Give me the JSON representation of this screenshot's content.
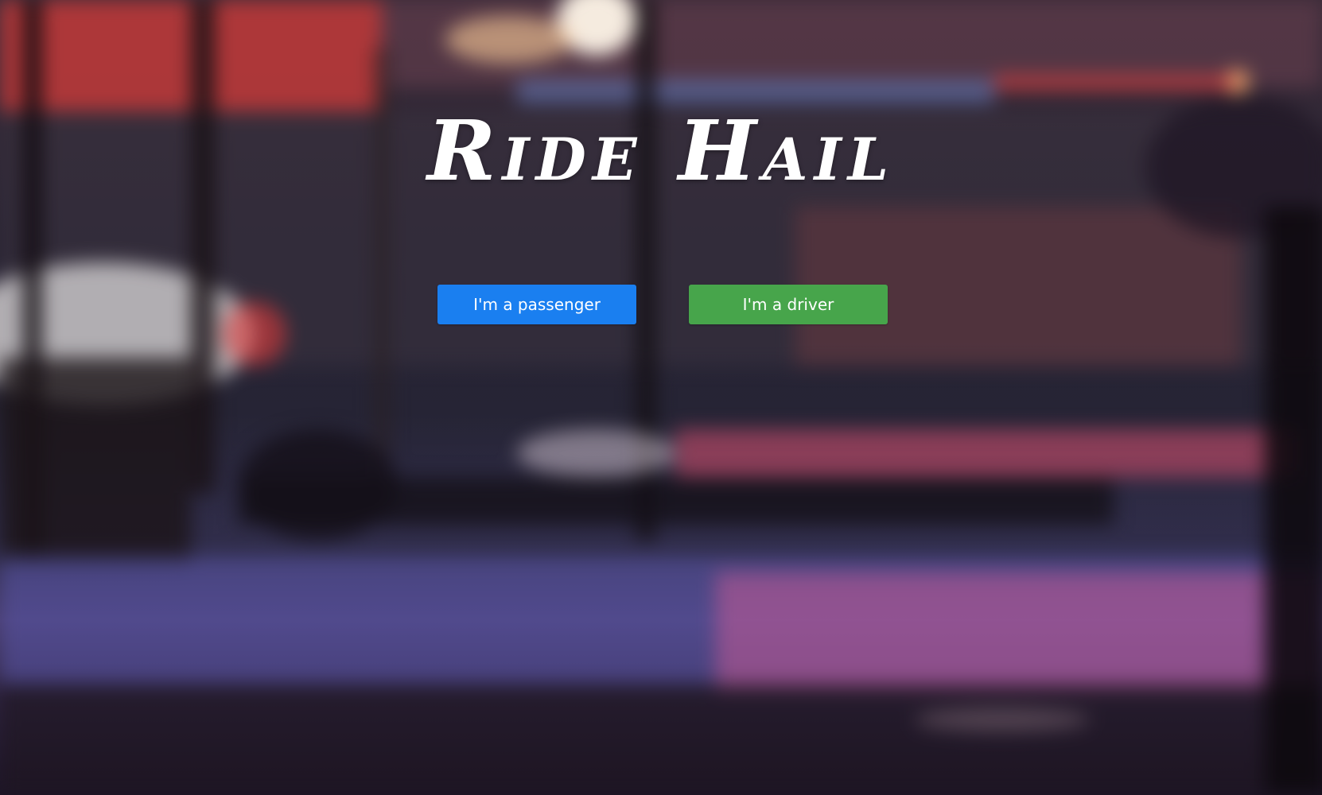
{
  "hero": {
    "title": "Ride Hail"
  },
  "actions": {
    "passenger_label": "I'm a passenger",
    "driver_label": "I'm a driver"
  },
  "colors": {
    "passenger_button": "#1a7ff0",
    "driver_button": "#47a54b",
    "title_text": "#ffffff"
  }
}
